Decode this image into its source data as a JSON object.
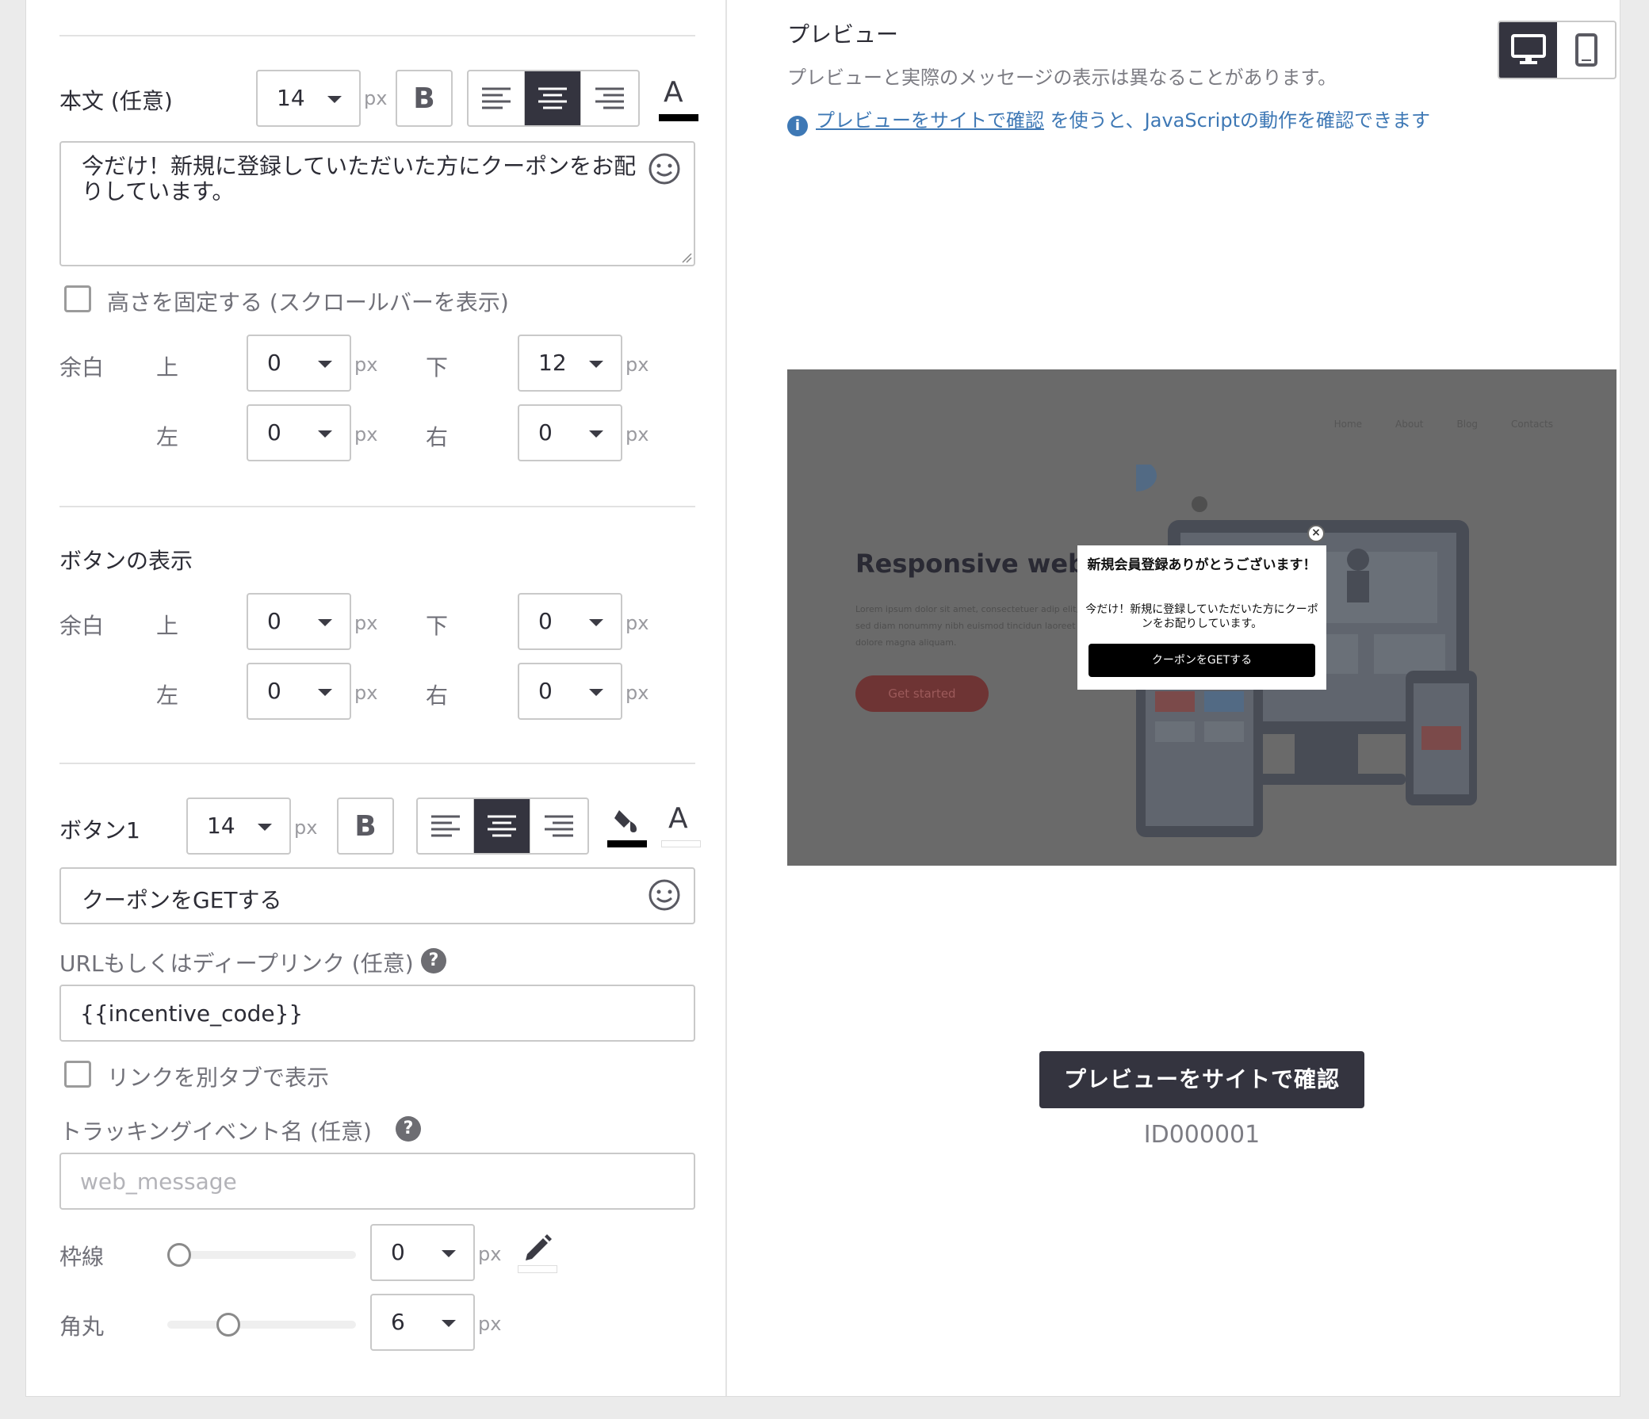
{
  "body_text": {
    "label": "本文 (任意)",
    "font_size": "14",
    "px": "px",
    "bold": "B",
    "color_a": "A",
    "content": "今だけ！新規に登録していただいた方にクーポンをお配りしています。",
    "fixed_height_label": "高さを固定する (スクロールバーを表示)",
    "margin_label": "余白",
    "top": "上",
    "bottom": "下",
    "left": "左",
    "right": "右",
    "margin_top": "0",
    "margin_bottom": "12",
    "margin_left": "0",
    "margin_right": "0"
  },
  "button_display": {
    "label": "ボタンの表示",
    "margin_label": "余白",
    "top": "上",
    "bottom": "下",
    "left": "左",
    "right": "右",
    "margin_top": "0",
    "margin_bottom": "0",
    "margin_left": "0",
    "margin_right": "0"
  },
  "button1": {
    "label": "ボタン1",
    "font_size": "14",
    "px": "px",
    "bold": "B",
    "color_a": "A",
    "text": "クーポンをGETする",
    "url_label": "URLもしくはディープリンク (任意)",
    "url_value": "{{incentive_code}}",
    "new_tab_label": "リンクを別タブで表示",
    "tracking_label": "トラッキングイベント名 (任意)",
    "tracking_placeholder": "web_message",
    "border_label": "枠線",
    "border_value": "0",
    "border_slider_level": 0,
    "radius_label": "角丸",
    "radius_value": "6",
    "radius_slider_level": 0.3,
    "help": "?"
  },
  "preview": {
    "title": "プレビュー",
    "note": "プレビューと実際のメッセージの表示は異なることがあります。",
    "info": "i",
    "link_text": "プレビューをサイトで確認",
    "link_suffix": " を使うと、JavaScriptの動作を確認できます",
    "site": {
      "nav": [
        "Home",
        "About",
        "Blog",
        "Contacts"
      ],
      "headline": "Responsive websit",
      "lorem": "Lorem ipsum dolor sit amet, consectetuer adip elit, sed diam nonummy nibh euismod tincidun laoreet dolore magna aliquam.",
      "cta": "Get started"
    },
    "modal": {
      "title": "新規会員登録ありがとうございます！",
      "body": "今だけ！新規に登録していただいた方にクーポンをお配りしています。",
      "button": "クーポンをGETする",
      "close": "×"
    },
    "confirm_button": "プレビューをサイトで確認",
    "id": "ID000001"
  },
  "colors": {
    "accent_dark": "#34343f",
    "link_blue": "#3e78b5"
  }
}
